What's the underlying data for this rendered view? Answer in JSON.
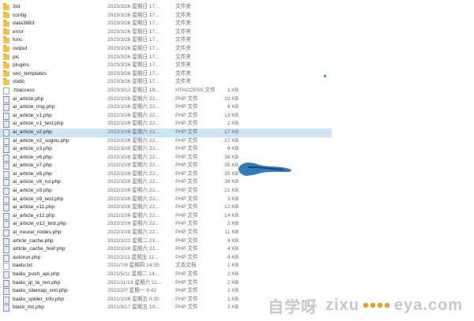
{
  "files": [
    {
      "name": "3rd",
      "date": "2023/3/26 星期日 17...",
      "type": "文件夹",
      "size": "",
      "kind": "folder"
    },
    {
      "name": "config",
      "date": "2023/3/26 星期日 17...",
      "type": "文件夹",
      "size": "",
      "kind": "folder"
    },
    {
      "name": "data3883",
      "date": "2023/3/26 星期日 17...",
      "type": "文件夹",
      "size": "",
      "kind": "folder"
    },
    {
      "name": "error",
      "date": "2023/3/26 星期日 17...",
      "type": "文件夹",
      "size": "",
      "kind": "folder"
    },
    {
      "name": "func",
      "date": "2023/3/26 星期日 17...",
      "type": "文件夹",
      "size": "",
      "kind": "folder"
    },
    {
      "name": "output",
      "date": "2023/3/26 星期日 17...",
      "type": "文件夹",
      "size": "",
      "kind": "folder"
    },
    {
      "name": "pic",
      "date": "2023/3/26 星期日 17...",
      "type": "文件夹",
      "size": "",
      "kind": "folder"
    },
    {
      "name": "plugins",
      "date": "2023/3/26 星期日 17...",
      "type": "文件夹",
      "size": "",
      "kind": "folder"
    },
    {
      "name": "seo_templates",
      "date": "2023/3/26 星期日 17...",
      "type": "文件夹",
      "size": "",
      "kind": "folder"
    },
    {
      "name": "static",
      "date": "2023/3/26 星期日 17...",
      "type": "文件夹",
      "size": "",
      "kind": "folder"
    },
    {
      "name": ".htaccess",
      "date": "2023/3/12 星期日 19...",
      "type": "HTACCESS 文件",
      "size": "1 KB",
      "kind": "file"
    },
    {
      "name": "ai_article.php",
      "date": "2022/10/8 星期六 22...",
      "type": "PHP 文件",
      "size": "10 KB",
      "kind": "php"
    },
    {
      "name": "ai_article_img.php",
      "date": "2022/10/8 星期六 22...",
      "type": "PHP 文件",
      "size": "6 KB",
      "kind": "php"
    },
    {
      "name": "ai_article_v1.php",
      "date": "2022/10/8 星期六 22...",
      "type": "PHP 文件",
      "size": "13 KB",
      "kind": "php"
    },
    {
      "name": "ai_article_v1_test.php",
      "date": "2022/10/8 星期六 22...",
      "type": "PHP 文件",
      "size": "2 KB",
      "kind": "php"
    },
    {
      "name": "ai_article_v2.php",
      "date": "2022/10/8 星期六 22...",
      "type": "PHP 文件",
      "size": "17 KB",
      "kind": "php",
      "selected": true
    },
    {
      "name": "ai_article_v2_sogou.php",
      "date": "2022/10/8 星期六 22...",
      "type": "PHP 文件",
      "size": "17 KB",
      "kind": "php"
    },
    {
      "name": "ai_article_v3.php",
      "date": "2022/10/8 星期六 22...",
      "type": "PHP 文件",
      "size": "8 KB",
      "kind": "php"
    },
    {
      "name": "ai_article_v6.php",
      "date": "2022/10/8 星期六 22...",
      "type": "PHP 文件",
      "size": "36 KB",
      "kind": "php"
    },
    {
      "name": "ai_article_v7.php",
      "date": "2022/10/8 星期六 22...",
      "type": "PHP 文件",
      "size": "35 KB",
      "kind": "php"
    },
    {
      "name": "ai_article_v8.php",
      "date": "2022/10/8 星期六 22...",
      "type": "PHP 文件",
      "size": "35 KB",
      "kind": "php"
    },
    {
      "name": "ai_article_v8_rul.php",
      "date": "2022/10/8 星期六 22...",
      "type": "PHP 文件",
      "size": "38 KB",
      "kind": "php"
    },
    {
      "name": "ai_article_v9.php",
      "date": "2022/10/8 星期六 22...",
      "type": "PHP 文件",
      "size": "21 KB",
      "kind": "php"
    },
    {
      "name": "ai_article_v9_test.php",
      "date": "2022/10/8 星期六 22...",
      "type": "PHP 文件",
      "size": "3 KB",
      "kind": "php"
    },
    {
      "name": "ai_article_v11.php",
      "date": "2022/10/8 星期六 22...",
      "type": "PHP 文件",
      "size": "12 KB",
      "kind": "php"
    },
    {
      "name": "ai_article_v12.php",
      "date": "2022/10/8 星期六 22...",
      "type": "PHP 文件",
      "size": "14 KB",
      "kind": "php"
    },
    {
      "name": "ai_article_v12_test.php",
      "date": "2022/10/8 星期六 22...",
      "type": "PHP 文件",
      "size": "2 KB",
      "kind": "php"
    },
    {
      "name": "ai_neural_nodes.php",
      "date": "2022/10/8 星期六 22...",
      "type": "PHP 文件",
      "size": "11 KB",
      "kind": "php"
    },
    {
      "name": "article_cache.php",
      "date": "2022/3/22 星期二 23...",
      "type": "PHP 文件",
      "size": "4 KB",
      "kind": "php"
    },
    {
      "name": "article_cache_href.php",
      "date": "2022/10/8 星期六 21...",
      "type": "PHP 文件",
      "size": "4 KB",
      "kind": "php"
    },
    {
      "name": "autorun.php",
      "date": "2022/2/11 星期五 11...",
      "type": "PHP 文件",
      "size": "4 KB",
      "kind": "php"
    },
    {
      "name": "baidu.txt",
      "date": "2021/7/8 星期四 14:35",
      "type": "文本文档",
      "size": "1 KB",
      "kind": "file"
    },
    {
      "name": "baidu_push_api.php",
      "date": "2021/5/11 星期二 14...",
      "type": "PHP 文件",
      "size": "2 KB",
      "kind": "php"
    },
    {
      "name": "baidu_qi_ta_ren.php",
      "date": "2021/11/13 星期六 11...",
      "type": "PHP 文件",
      "size": "2 KB",
      "kind": "php"
    },
    {
      "name": "baidu_sitemap_xml.php",
      "date": "2022/2/7 星期一 9:42",
      "type": "PHP 文件",
      "size": "2 KB",
      "kind": "php"
    },
    {
      "name": "baidu_spider_info.php",
      "date": "2021/10/8 星期五 0:30",
      "type": "PHP 文件",
      "size": "1 KB",
      "kind": "php"
    },
    {
      "name": "black_list.php",
      "date": "2021/9/17 星期五 19...",
      "type": "PHP 文件",
      "size": "2 KB",
      "kind": "php"
    }
  ],
  "watermark": {
    "cn": "自学呀",
    "domain1": "zixu",
    "domain2": "eya.com"
  },
  "colors": {
    "folder": "#f2c14e",
    "selected": "#cce4f7",
    "scribble": "#1f6fb2",
    "watermark_dots": "#e3a21a"
  }
}
